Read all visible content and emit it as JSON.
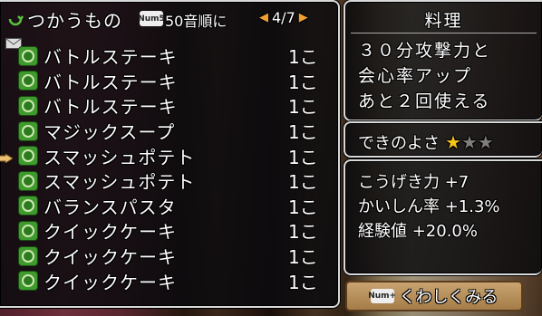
{
  "list_panel": {
    "title": "つかうもの",
    "sort_key": "Num5",
    "sort_label": "50音順に",
    "page": "4/7",
    "items": [
      {
        "name": "バトルステーキ",
        "qty": "1こ"
      },
      {
        "name": "バトルステーキ",
        "qty": "1こ"
      },
      {
        "name": "バトルステーキ",
        "qty": "1こ"
      },
      {
        "name": "マジックスープ",
        "qty": "1こ"
      },
      {
        "name": "スマッシュポテト",
        "qty": "1こ"
      },
      {
        "name": "スマッシュポテト",
        "qty": "1こ"
      },
      {
        "name": "バランスパスタ",
        "qty": "1こ"
      },
      {
        "name": "クイックケーキ",
        "qty": "1こ"
      },
      {
        "name": "クイックケーキ",
        "qty": "1こ"
      },
      {
        "name": "クイックケーキ",
        "qty": "1こ"
      }
    ],
    "selected_index": 4
  },
  "info_panel": {
    "title": "料理",
    "description": [
      "３０分攻撃力と",
      "会心率アップ",
      "あと２回使える"
    ]
  },
  "quality_panel": {
    "label": "できのよさ",
    "stars_filled": 1,
    "stars_total": 3
  },
  "stats_panel": {
    "lines": [
      "こうげき力 +7",
      "かいしん率 +1.3%",
      "経験値 +20.0%"
    ]
  },
  "detail_button": {
    "key": "Num+",
    "label": "くわしくみる"
  },
  "colors": {
    "item_icon": "#3f9a2e",
    "arrow": "#f0a030",
    "star_filled": "#f5c518",
    "star_empty": "#7d7d7d"
  }
}
